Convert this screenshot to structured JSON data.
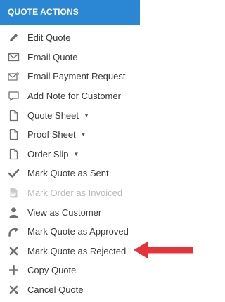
{
  "header": {
    "title": "QUOTE ACTIONS"
  },
  "colors": {
    "header_bg": "#2b87d3",
    "icon": "#6f6f6f",
    "disabled": "#b8b8b8",
    "arrow": "#e8323a"
  },
  "menu": {
    "items": [
      {
        "label": "Edit Quote",
        "icon": "pencil-icon"
      },
      {
        "label": "Email Quote",
        "icon": "envelope-icon"
      },
      {
        "label": "Email Payment Request",
        "icon": "envelope-dollar-icon"
      },
      {
        "label": "Add Note for Customer",
        "icon": "comment-icon"
      },
      {
        "label": "Quote Sheet",
        "icon": "document-icon",
        "has_dropdown": true
      },
      {
        "label": "Proof Sheet",
        "icon": "document-icon",
        "has_dropdown": true
      },
      {
        "label": "Order Slip",
        "icon": "document-icon",
        "has_dropdown": true
      },
      {
        "label": "Mark Quote as Sent",
        "icon": "checkmark-icon"
      },
      {
        "label": "Mark Order as Invoiced",
        "icon": "invoice-icon",
        "disabled": true
      },
      {
        "label": "View as Customer",
        "icon": "user-icon"
      },
      {
        "label": "Mark Quote as Approved",
        "icon": "redo-icon"
      },
      {
        "label": "Mark Quote as Rejected",
        "icon": "x-icon"
      },
      {
        "label": "Copy Quote",
        "icon": "plus-icon"
      },
      {
        "label": "Cancel Quote",
        "icon": "x-icon"
      }
    ]
  },
  "annotation": {
    "arrow_target": "Mark Quote as Rejected"
  }
}
